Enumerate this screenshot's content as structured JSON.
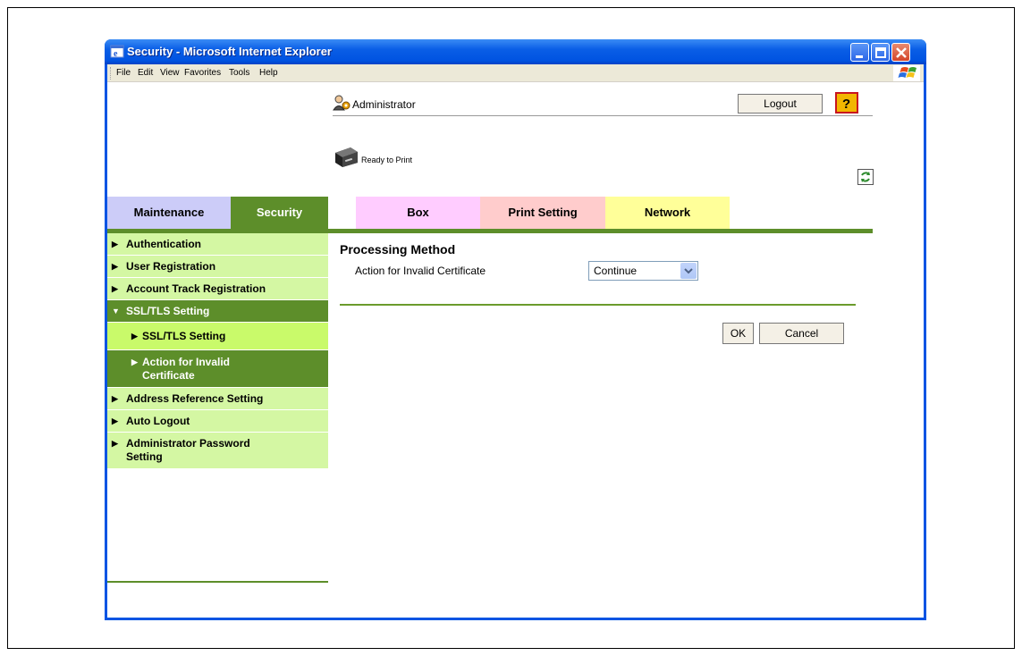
{
  "window": {
    "title": "Security - Microsoft Internet Explorer"
  },
  "menubar": [
    "File",
    "Edit",
    "View",
    "Favorites",
    "Tools",
    "Help"
  ],
  "header": {
    "user_label": "Administrator",
    "logout_label": "Logout",
    "help_label": "?",
    "status_text": "Ready to Print"
  },
  "tabs": [
    {
      "label": "Maintenance",
      "color": "#ccccf8"
    },
    {
      "label": "Security",
      "color": "#5d8e2a",
      "active": true
    },
    {
      "label": "Box",
      "color": "#ffccff"
    },
    {
      "label": "Print Setting",
      "color": "#ffcccc"
    },
    {
      "label": "Network",
      "color": "#ffff99"
    }
  ],
  "sidebar": {
    "items": [
      {
        "label": "Authentication"
      },
      {
        "label": "User Registration"
      },
      {
        "label": "Account Track Registration"
      },
      {
        "label": "SSL/TLS Setting",
        "expanded": true
      },
      {
        "label": "SSL/TLS Setting",
        "sub": true
      },
      {
        "label": "Action for Invalid Certificate",
        "sub": true,
        "selected": true
      },
      {
        "label": "Address Reference Setting"
      },
      {
        "label": "Auto Logout"
      },
      {
        "label": "Administrator Password Setting"
      }
    ]
  },
  "main": {
    "section_title": "Processing Method",
    "field_label": "Action for Invalid Certificate",
    "select_value": "Continue",
    "ok_label": "OK",
    "cancel_label": "Cancel"
  },
  "colors": {
    "accent_green": "#5d8e2a",
    "nav_light": "#d4f7a3",
    "nav_sub": "#c9fa6a",
    "titlebar_blue": "#0054e3"
  }
}
